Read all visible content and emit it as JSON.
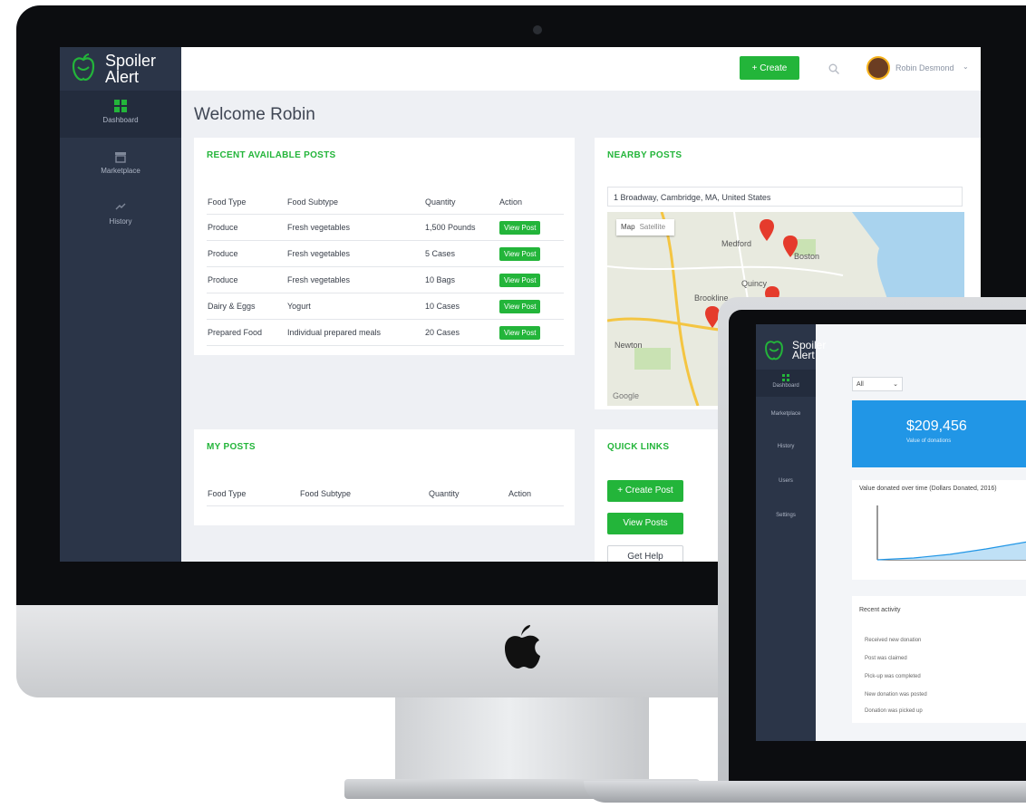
{
  "app": {
    "name_line1": "Spoiler",
    "name_line2": "Alert"
  },
  "sidebar": {
    "items": [
      {
        "label": "Dashboard",
        "icon": "grid-icon"
      },
      {
        "label": "Marketplace",
        "icon": "store-icon"
      },
      {
        "label": "History",
        "icon": "history-icon"
      }
    ]
  },
  "topbar": {
    "create_label": "+ Create",
    "user_name": "Robin Desmond"
  },
  "page": {
    "welcome": "Welcome Robin"
  },
  "recent_posts": {
    "title": "RECENT AVAILABLE POSTS",
    "columns": [
      "Food Type",
      "Food Subtype",
      "Quantity",
      "Action"
    ],
    "rows": [
      {
        "type": "Produce",
        "subtype": "Fresh vegetables",
        "quantity": "1,500 Pounds",
        "action": "View Post"
      },
      {
        "type": "Produce",
        "subtype": "Fresh vegetables",
        "quantity": "5 Cases",
        "action": "View Post"
      },
      {
        "type": "Produce",
        "subtype": "Fresh vegetables",
        "quantity": "10 Bags",
        "action": "View Post"
      },
      {
        "type": "Dairy & Eggs",
        "subtype": "Yogurt",
        "quantity": "10 Cases",
        "action": "View Post"
      },
      {
        "type": "Prepared Food",
        "subtype": "Individual prepared meals",
        "quantity": "20 Cases",
        "action": "View Post"
      }
    ]
  },
  "nearby": {
    "title": "NEARBY POSTS",
    "search_value": "1 Broadway, Cambridge, MA, United States",
    "map_toggle": [
      "Map",
      "Satellite"
    ],
    "places": [
      "Medford",
      "Quincy",
      "Brookline",
      "Newton",
      "Boston",
      "Google"
    ]
  },
  "my_posts": {
    "title": "MY POSTS",
    "columns": [
      "Food Type",
      "Food Subtype",
      "Quantity",
      "Action"
    ]
  },
  "quick_links": {
    "title": "QUICK LINKS",
    "buttons": [
      "+ Create Post",
      "View Posts",
      "Get Help"
    ]
  },
  "laptop": {
    "name_line1": "Spoiler",
    "name_line2": "Alert",
    "nav": [
      "Dashboard",
      "Marketplace",
      "History",
      "Users",
      "Settings"
    ],
    "dropdown": "All",
    "stat_value": "$209,456",
    "stat_label": "Value of donations",
    "chart_title": "Value donated over time (Dollars Donated, 2016)",
    "list_title": "Recent activity",
    "list_items": [
      "Received new donation",
      "Post was claimed",
      "Pick-up was completed",
      "New donation was posted",
      "Donation was picked up"
    ]
  },
  "colors": {
    "brand_green": "#23b53a",
    "sidebar_navy": "#2b3548",
    "stat_blue": "#2196e6"
  }
}
